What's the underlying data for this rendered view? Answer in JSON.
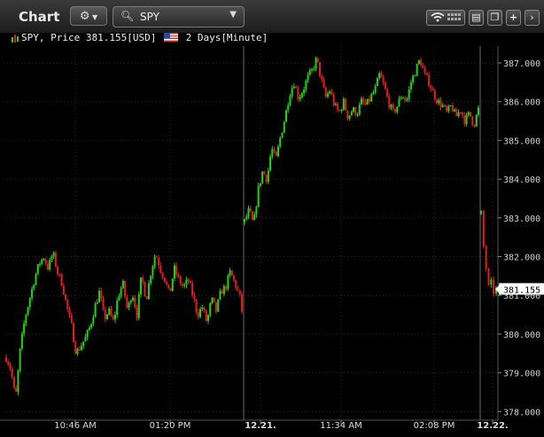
{
  "window": {
    "title": "Chart"
  },
  "toolbar": {
    "gear_icon": "gear-icon",
    "search_value": "SPY",
    "buttons": [
      "wifi-signal-icon",
      "layout-icon",
      "popout-icon",
      "add-icon",
      "chevron-right-icon"
    ]
  },
  "info": {
    "symbol": "SPY, Price 381.155[USD]",
    "period": "2 Days[Minute]"
  },
  "colors": {
    "up": "#22d40d",
    "down": "#e21d1d",
    "background": "#000000",
    "grid": "#2a2a2a"
  },
  "chart_data": {
    "type": "candlestick",
    "y_ticks": [
      "387.000",
      "386.000",
      "385.000",
      "384.000",
      "383.000",
      "382.000",
      "381.000",
      "380.000",
      "379.000",
      "378.000"
    ],
    "ylim": [
      377.85,
      388.1
    ],
    "x_ticks": [
      "10:46 AM",
      "01:20 PM",
      "12.21.",
      "11:34 AM",
      "02:08 PM",
      "12.22."
    ],
    "last_price": "381.155",
    "day1_path": [
      [
        0,
        379.4
      ],
      [
        4,
        379.1
      ],
      [
        8,
        378.3
      ],
      [
        12,
        379.6
      ],
      [
        16,
        380.4
      ],
      [
        20,
        380.9
      ],
      [
        24,
        381.4
      ],
      [
        28,
        381.8
      ],
      [
        32,
        382.0
      ],
      [
        36,
        381.7
      ],
      [
        40,
        382.1
      ],
      [
        44,
        381.6
      ],
      [
        48,
        381.3
      ],
      [
        52,
        380.7
      ],
      [
        56,
        380.2
      ],
      [
        60,
        379.5
      ],
      [
        64,
        379.7
      ],
      [
        68,
        379.9
      ],
      [
        72,
        380.2
      ],
      [
        76,
        380.7
      ],
      [
        80,
        381.1
      ],
      [
        84,
        380.4
      ],
      [
        88,
        380.6
      ],
      [
        92,
        380.3
      ],
      [
        96,
        381.0
      ],
      [
        100,
        381.3
      ],
      [
        104,
        380.6
      ],
      [
        108,
        381.1
      ],
      [
        112,
        380.5
      ],
      [
        116,
        381.5
      ],
      [
        120,
        380.9
      ],
      [
        124,
        381.6
      ],
      [
        128,
        382.1
      ],
      [
        132,
        381.7
      ],
      [
        136,
        381.4
      ],
      [
        140,
        381.0
      ],
      [
        144,
        381.7
      ],
      [
        148,
        381.4
      ],
      [
        152,
        381.2
      ],
      [
        156,
        381.4
      ],
      [
        160,
        381.0
      ],
      [
        164,
        380.5
      ],
      [
        168,
        380.7
      ],
      [
        172,
        380.3
      ],
      [
        176,
        380.9
      ],
      [
        180,
        380.6
      ],
      [
        184,
        381.1
      ],
      [
        188,
        381.2
      ],
      [
        192,
        381.6
      ],
      [
        196,
        381.3
      ],
      [
        200,
        381.0
      ],
      [
        202,
        380.6
      ]
    ],
    "day2_path": [
      [
        0,
        382.9
      ],
      [
        4,
        383.2
      ],
      [
        8,
        382.8
      ],
      [
        12,
        383.7
      ],
      [
        16,
        384.2
      ],
      [
        20,
        384.0
      ],
      [
        24,
        384.8
      ],
      [
        28,
        384.5
      ],
      [
        32,
        385.1
      ],
      [
        36,
        385.6
      ],
      [
        40,
        386.2
      ],
      [
        44,
        386.5
      ],
      [
        48,
        386.1
      ],
      [
        52,
        386.3
      ],
      [
        56,
        386.6
      ],
      [
        60,
        386.8
      ],
      [
        64,
        387.1
      ],
      [
        68,
        386.6
      ],
      [
        72,
        386.1
      ],
      [
        76,
        386.3
      ],
      [
        80,
        385.9
      ],
      [
        84,
        385.7
      ],
      [
        88,
        386.0
      ],
      [
        92,
        385.6
      ],
      [
        96,
        385.8
      ],
      [
        100,
        385.7
      ],
      [
        104,
        386.0
      ],
      [
        108,
        385.9
      ],
      [
        112,
        386.1
      ],
      [
        116,
        386.3
      ],
      [
        120,
        386.7
      ],
      [
        124,
        386.4
      ],
      [
        128,
        386.0
      ],
      [
        132,
        385.7
      ],
      [
        136,
        385.9
      ],
      [
        140,
        386.2
      ],
      [
        144,
        386.0
      ],
      [
        148,
        386.5
      ],
      [
        152,
        386.8
      ],
      [
        156,
        387.1
      ],
      [
        160,
        386.7
      ],
      [
        164,
        386.5
      ],
      [
        168,
        386.2
      ],
      [
        172,
        386.0
      ],
      [
        176,
        385.9
      ],
      [
        180,
        385.7
      ],
      [
        184,
        385.9
      ],
      [
        188,
        385.6
      ],
      [
        192,
        385.8
      ],
      [
        196,
        385.5
      ],
      [
        200,
        385.7
      ],
      [
        204,
        385.4
      ],
      [
        208,
        385.8
      ]
    ],
    "day3_path": [
      [
        0,
        383.1
      ],
      [
        2,
        382.5
      ],
      [
        4,
        382.0
      ],
      [
        6,
        381.7
      ],
      [
        8,
        381.3
      ],
      [
        10,
        381.1
      ],
      [
        12,
        381.3
      ],
      [
        14,
        381.0
      ],
      [
        16,
        381.2
      ],
      [
        18,
        381.155
      ]
    ]
  }
}
